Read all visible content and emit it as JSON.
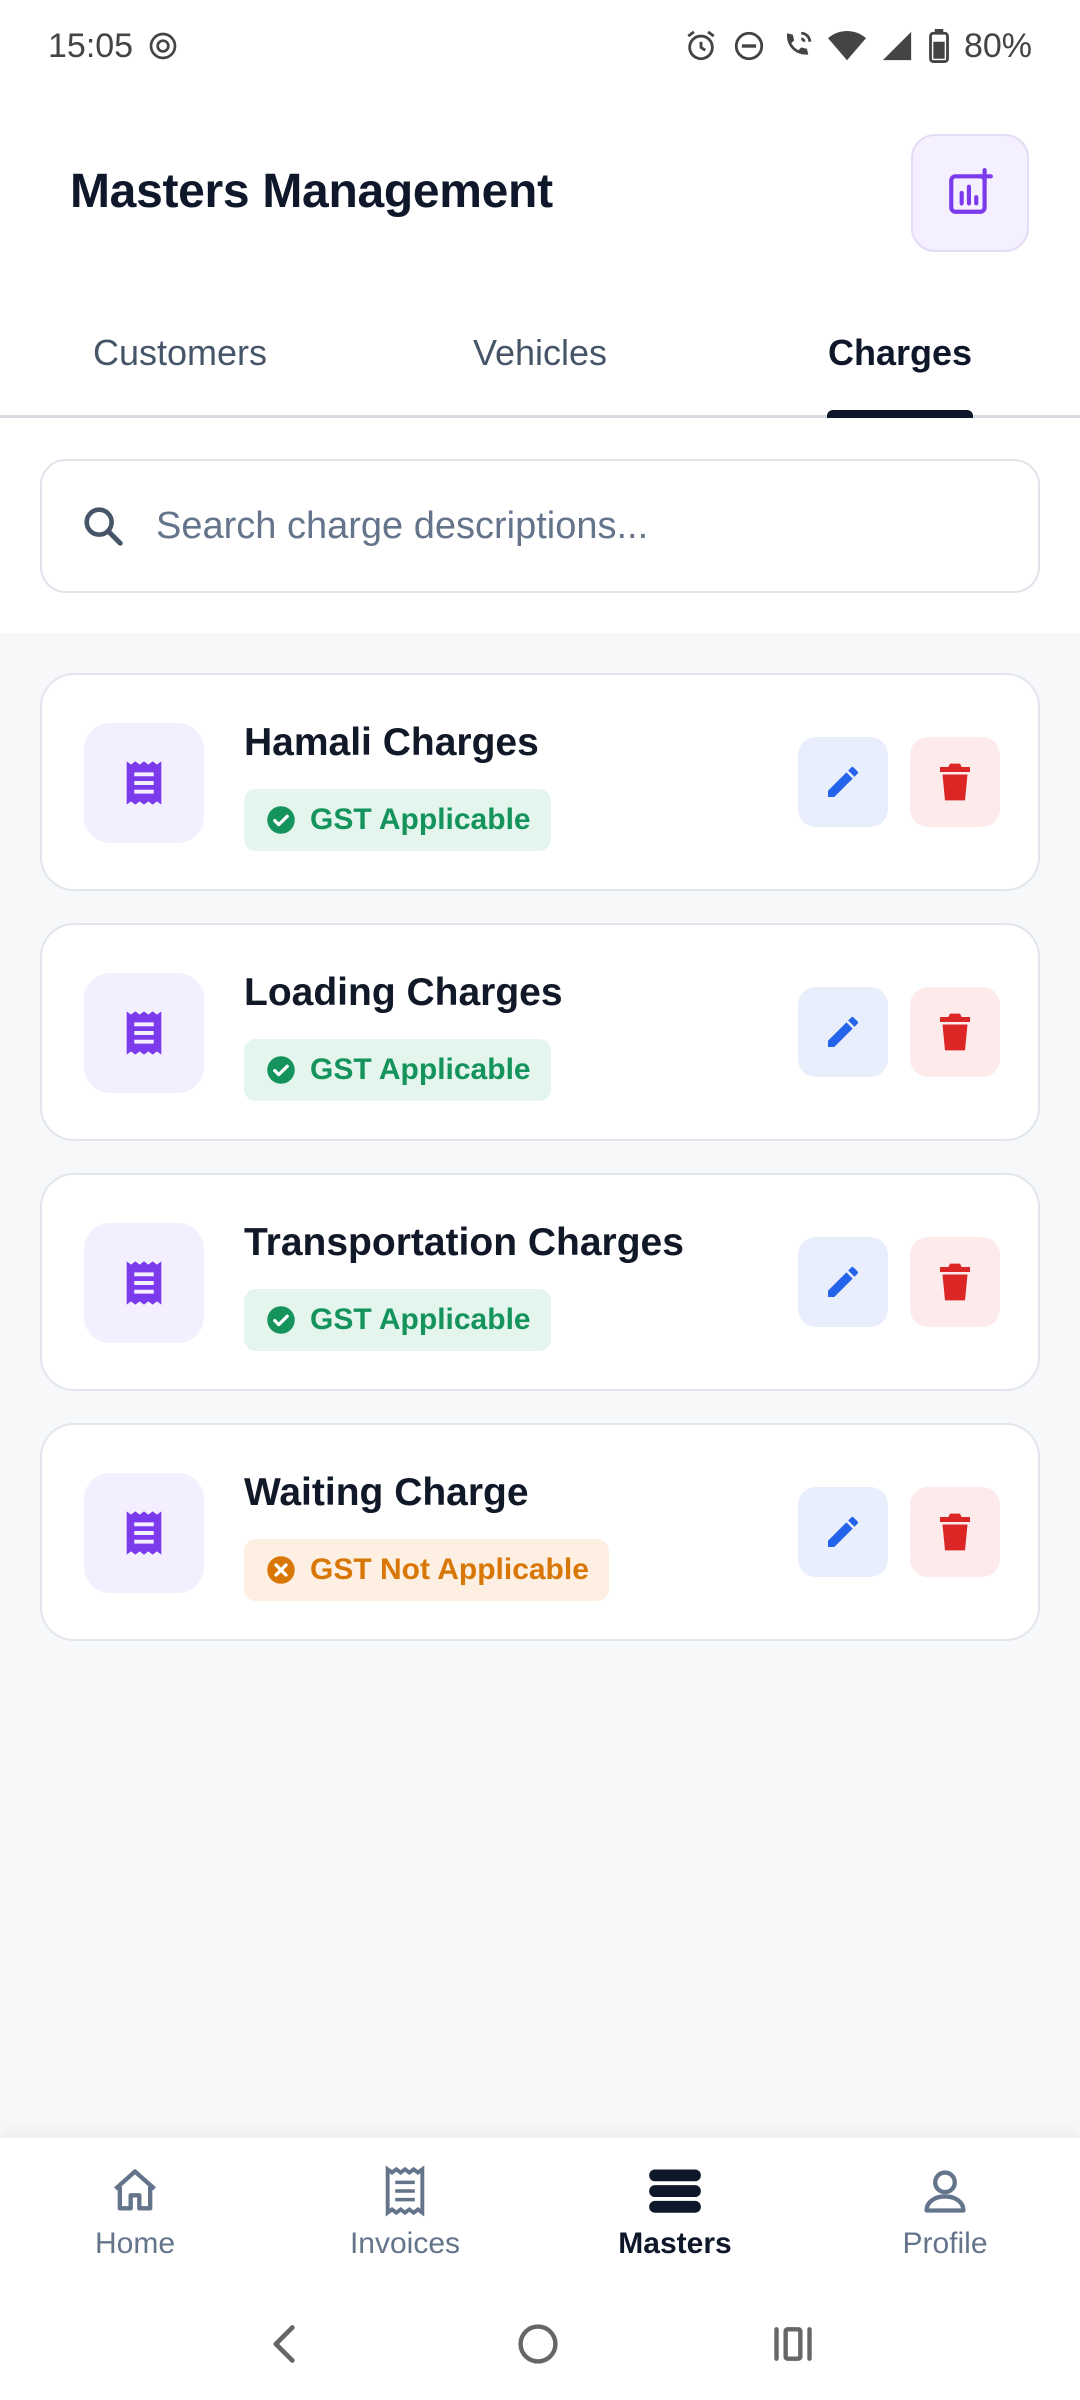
{
  "status_bar": {
    "time": "15:05",
    "battery": "80%",
    "icons": [
      "alarm-icon",
      "dnd-icon",
      "wifi-calling-icon",
      "wifi-icon",
      "signal-icon",
      "battery-icon"
    ]
  },
  "header": {
    "title": "Masters Management",
    "action_icon": "report-add-icon"
  },
  "tabs": [
    {
      "label": "Customers",
      "active": false
    },
    {
      "label": "Vehicles",
      "active": false
    },
    {
      "label": "Charges",
      "active": true
    }
  ],
  "search": {
    "placeholder": "Search charge descriptions..."
  },
  "charges": [
    {
      "name": "Hamali Charges",
      "gst_label": "GST Applicable",
      "gst": true
    },
    {
      "name": "Loading Charges",
      "gst_label": "GST Applicable",
      "gst": true
    },
    {
      "name": "Transportation Charges",
      "gst_label": "GST Applicable",
      "gst": true
    },
    {
      "name": "Waiting Charge",
      "gst_label": "GST Not Applicable",
      "gst": false
    }
  ],
  "bottom_nav": [
    {
      "label": "Home",
      "icon": "home-icon",
      "active": false
    },
    {
      "label": "Invoices",
      "icon": "receipt-icon",
      "active": false
    },
    {
      "label": "Masters",
      "icon": "database-icon",
      "active": true
    },
    {
      "label": "Profile",
      "icon": "person-icon",
      "active": false
    }
  ],
  "colors": {
    "accent_purple": "#7c3aed",
    "gst_ok": "#15935c",
    "gst_no": "#d97706",
    "edit_blue": "#2563eb",
    "delete_red": "#dc2626"
  }
}
